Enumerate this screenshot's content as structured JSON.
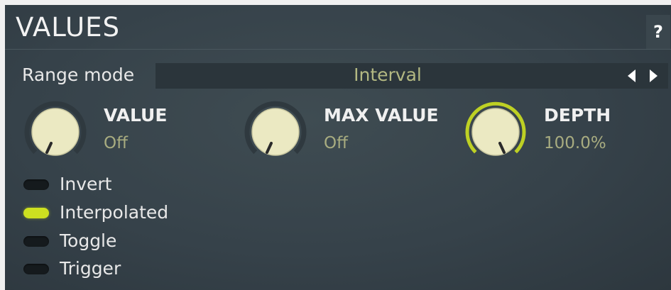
{
  "header": {
    "title": "VALUES",
    "help_label": "?"
  },
  "range_mode": {
    "label": "Range mode",
    "value": "Interval"
  },
  "knobs": [
    {
      "name": "VALUE",
      "value": "Off",
      "active": false
    },
    {
      "name": "MAX VALUE",
      "value": "Off",
      "active": false
    },
    {
      "name": "DEPTH",
      "value": "100.0%",
      "active": true
    }
  ],
  "switches": [
    {
      "label": "Invert",
      "on": false
    },
    {
      "label": "Interpolated",
      "on": true
    },
    {
      "label": "Toggle",
      "on": false
    },
    {
      "label": "Trigger",
      "on": false
    }
  ],
  "colors": {
    "panel": "#36424a",
    "accent_on": "#cde020",
    "value_text": "#a8ac80",
    "knob_face": "#ebe9c2"
  }
}
